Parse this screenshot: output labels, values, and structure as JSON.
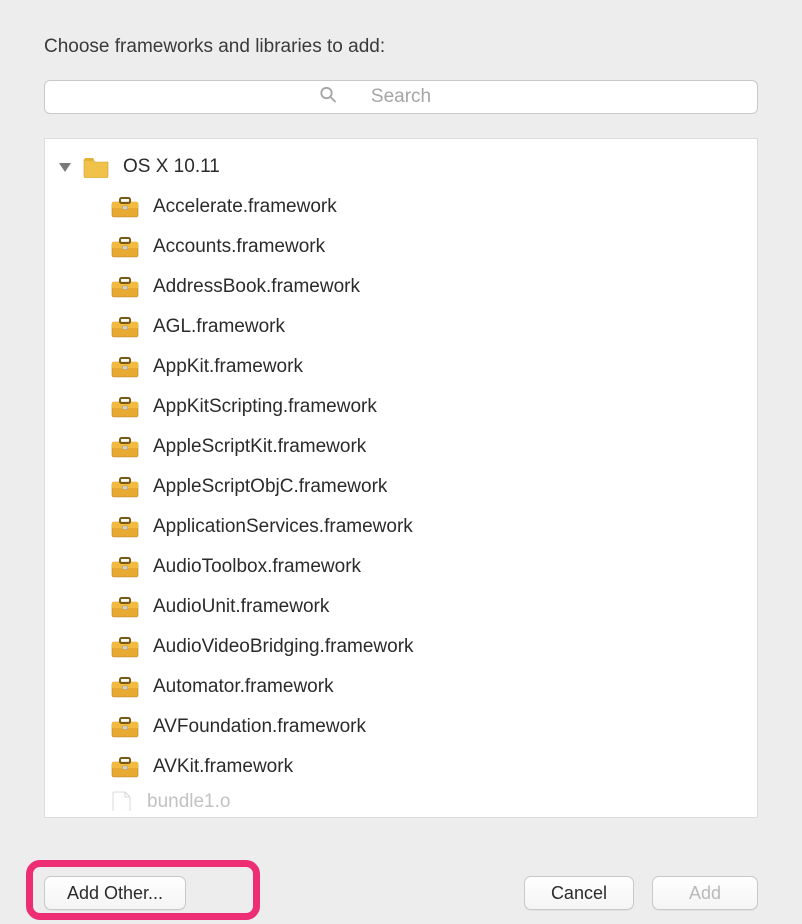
{
  "prompt": "Choose frameworks and libraries to add:",
  "search": {
    "placeholder": "Search",
    "value": ""
  },
  "tree": {
    "root_label": "OS X 10.11",
    "items": [
      {
        "label": "Accelerate.framework"
      },
      {
        "label": "Accounts.framework"
      },
      {
        "label": "AddressBook.framework"
      },
      {
        "label": "AGL.framework"
      },
      {
        "label": "AppKit.framework"
      },
      {
        "label": "AppKitScripting.framework"
      },
      {
        "label": "AppleScriptKit.framework"
      },
      {
        "label": "AppleScriptObjC.framework"
      },
      {
        "label": "ApplicationServices.framework"
      },
      {
        "label": "AudioToolbox.framework"
      },
      {
        "label": "AudioUnit.framework"
      },
      {
        "label": "AudioVideoBridging.framework"
      },
      {
        "label": "Automator.framework"
      },
      {
        "label": "AVFoundation.framework"
      },
      {
        "label": "AVKit.framework"
      }
    ],
    "partial_item": "bundle1.o"
  },
  "buttons": {
    "add_other": "Add Other...",
    "cancel": "Cancel",
    "add": "Add"
  }
}
